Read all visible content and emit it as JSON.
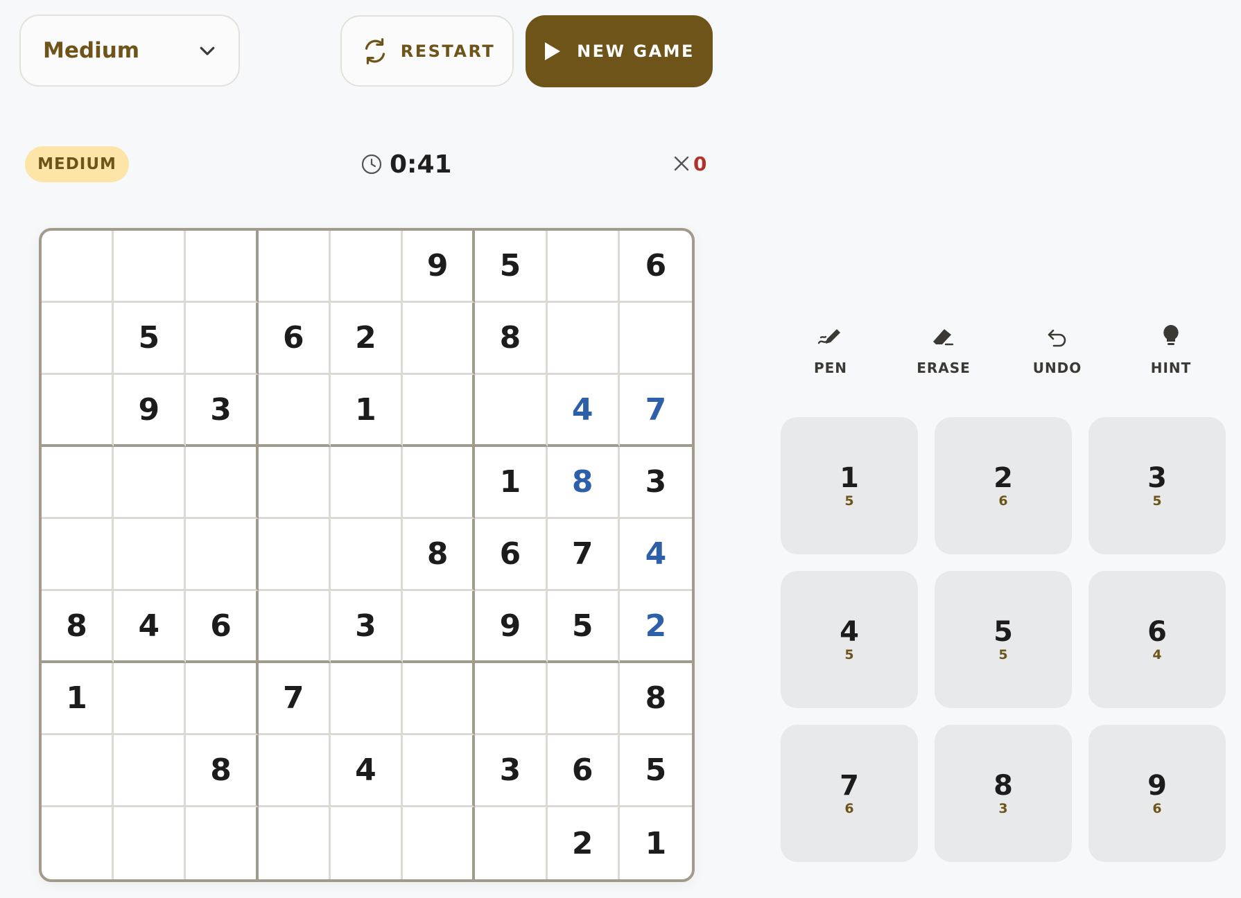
{
  "header": {
    "difficulty_value": "Medium",
    "restart_label": "RESTART",
    "new_game_label": "NEW GAME"
  },
  "status": {
    "level": "MEDIUM",
    "timer": "0:41",
    "mistakes": "0"
  },
  "board": {
    "rows": [
      [
        "",
        "",
        "",
        "",
        "",
        "9",
        "5",
        "",
        "6"
      ],
      [
        "",
        "5",
        "",
        "6",
        "2",
        "",
        "8",
        "",
        ""
      ],
      [
        "",
        "9",
        "3",
        "",
        "1",
        "",
        "",
        "4",
        "7"
      ],
      [
        "",
        "",
        "",
        "",
        "",
        "",
        "1",
        "8",
        "3"
      ],
      [
        "",
        "",
        "",
        "",
        "",
        "8",
        "6",
        "7",
        "4"
      ],
      [
        "8",
        "4",
        "6",
        "",
        "3",
        "",
        "9",
        "5",
        "2"
      ],
      [
        "1",
        "",
        "",
        "7",
        "",
        "",
        "",
        "",
        "8"
      ],
      [
        "",
        "",
        "8",
        "",
        "4",
        "",
        "3",
        "6",
        "5"
      ],
      [
        "",
        "",
        "",
        "",
        "",
        "",
        "",
        "2",
        "1"
      ]
    ],
    "entered_cells": [
      [
        2,
        7
      ],
      [
        2,
        8
      ],
      [
        3,
        7
      ],
      [
        4,
        8
      ],
      [
        5,
        8
      ]
    ]
  },
  "tools": [
    {
      "label": "PEN",
      "icon": "pen-icon"
    },
    {
      "label": "ERASE",
      "icon": "eraser-icon"
    },
    {
      "label": "UNDO",
      "icon": "undo-icon"
    },
    {
      "label": "HINT",
      "icon": "lightbulb-icon"
    }
  ],
  "numpad": [
    {
      "digit": "1",
      "remaining": "5"
    },
    {
      "digit": "2",
      "remaining": "6"
    },
    {
      "digit": "3",
      "remaining": "5"
    },
    {
      "digit": "4",
      "remaining": "5"
    },
    {
      "digit": "5",
      "remaining": "5"
    },
    {
      "digit": "6",
      "remaining": "4"
    },
    {
      "digit": "7",
      "remaining": "6"
    },
    {
      "digit": "8",
      "remaining": "3"
    },
    {
      "digit": "9",
      "remaining": "6"
    }
  ],
  "colors": {
    "accent": "#6e5419",
    "entered_digit": "#2d60a8",
    "mistake": "#b3312d",
    "badge_bg": "#fce5a6"
  }
}
